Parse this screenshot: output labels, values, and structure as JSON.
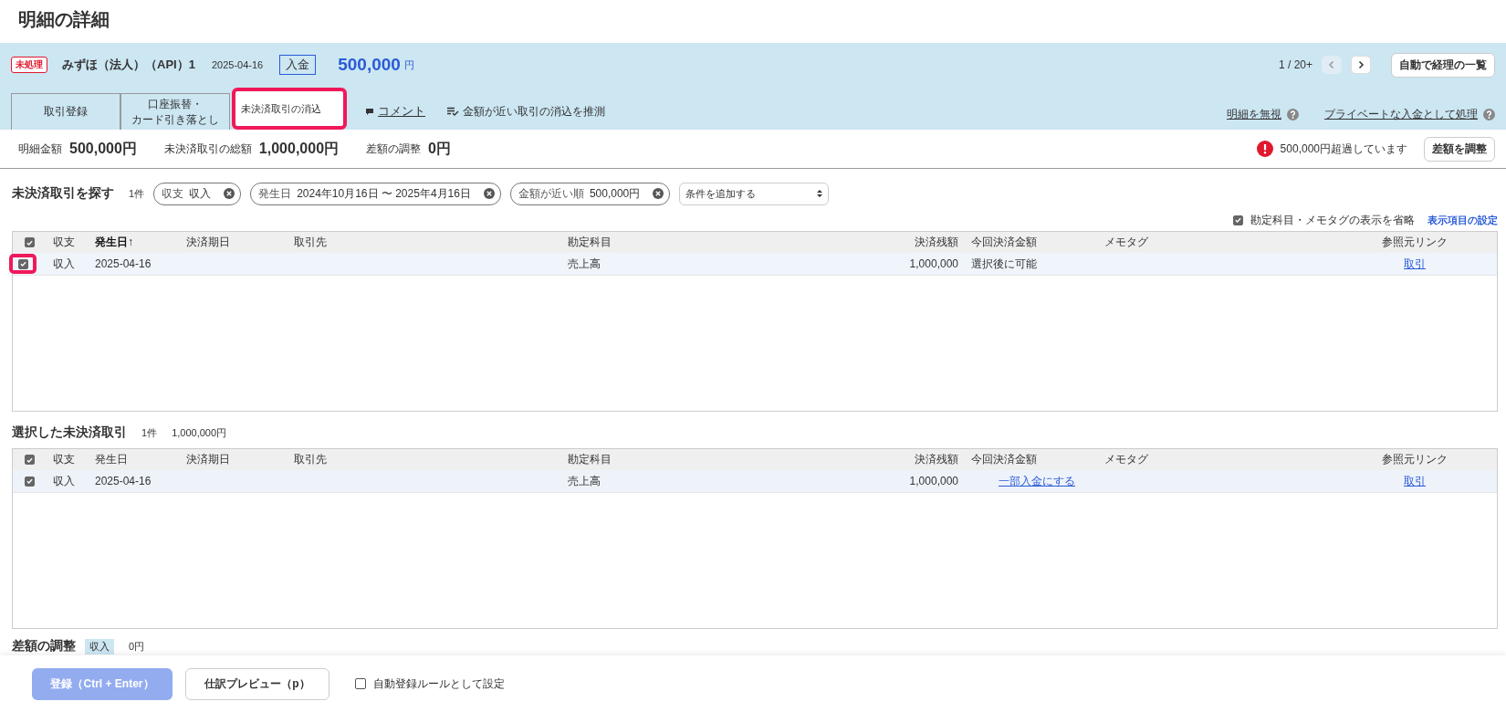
{
  "page_title": "明細の詳細",
  "header": {
    "status_badge": "未処理",
    "account": "みずほ（法人）（API）1",
    "date": "2025-04-16",
    "direction": "入金",
    "amount": "500,000",
    "currency": "円",
    "pager": {
      "position": "1 / 20+",
      "prev_disabled": true,
      "next_disabled": false
    },
    "list_button": "自動で経理の一覧"
  },
  "tabs": [
    {
      "kind": "tab",
      "label": "取引登録",
      "selected": false
    },
    {
      "kind": "tab2",
      "lines": [
        "口座振替・",
        "カード引き落とし"
      ],
      "selected": false
    },
    {
      "kind": "tab",
      "label": "未決済取引の消込",
      "selected": true
    },
    {
      "kind": "comment",
      "label": "コメント",
      "selected": false
    },
    {
      "kind": "guess",
      "label": "金額が近い取引の消込を推測",
      "selected": false
    }
  ],
  "header_links": [
    "明細を無視",
    "プライベートな入金として処理"
  ],
  "summary": [
    {
      "label": "明細金額",
      "value": "500,000円"
    },
    {
      "label": "未決済取引の総額",
      "value": "1,000,000円"
    },
    {
      "label": "差額の調整",
      "value": "0円"
    }
  ],
  "warning": "500,000円超過しています",
  "adjust_button": "差額を調整",
  "search": {
    "title": "未決済取引を探す",
    "count": "1件",
    "filters": [
      {
        "label": "収支",
        "value": "収入"
      },
      {
        "label": "発生日",
        "value": "2024年10月16日 〜 2025年4月16日"
      },
      {
        "label": "金額が近い順",
        "value": "500,000円"
      }
    ],
    "add_condition": "条件を追加する",
    "omit_option": {
      "label": "勘定科目・メモタグの表示を省略",
      "checked": true
    },
    "settings_link": "表示項目の設定"
  },
  "search_table": {
    "all_checked": true,
    "columns": [
      {
        "label": "収支",
        "sorted": false
      },
      {
        "label": "発生日",
        "sorted": true,
        "sort_arrow": "↑"
      },
      {
        "label": "決済期日",
        "sorted": false
      },
      {
        "label": "取引先",
        "sorted": false
      },
      {
        "label": "勘定科目",
        "sorted": false
      },
      {
        "label": "決済残額",
        "sorted": false
      },
      {
        "label": "今回決済金額",
        "sorted": false
      },
      {
        "label": "メモタグ",
        "sorted": false
      },
      {
        "label": "参照元リンク",
        "sorted": false
      }
    ],
    "rows": [
      {
        "checked": true,
        "highlighted": true,
        "type": "収入",
        "date": "2025-04-16",
        "amount_account": "売上高",
        "balance": "1,000,000",
        "payment": "選択後に可能",
        "payment_is_link": false,
        "link": "取引"
      }
    ]
  },
  "selected": {
    "title": "選択した未決済取引",
    "count": "1件",
    "total": "1,000,000円"
  },
  "selected_table": {
    "all_checked": true,
    "columns": [
      {
        "label": "収支",
        "sorted": false
      },
      {
        "label": "発生日",
        "sorted": false
      },
      {
        "label": "決済期日",
        "sorted": false
      },
      {
        "label": "取引先",
        "sorted": false
      },
      {
        "label": "勘定科目",
        "sorted": false
      },
      {
        "label": "決済残額",
        "sorted": false
      },
      {
        "label": "今回決済金額",
        "sorted": false
      },
      {
        "label": "メモタグ",
        "sorted": false
      },
      {
        "label": "参照元リンク",
        "sorted": false
      }
    ],
    "rows": [
      {
        "checked": true,
        "highlighted": false,
        "type": "収入",
        "date": "2025-04-16",
        "amount_account": "売上高",
        "balance": "1,000,000",
        "payment": "一部入金にする",
        "payment_is_link": true,
        "link": "取引"
      }
    ]
  },
  "adjustment": {
    "title": "差額の調整",
    "tag": "収入",
    "value": "0円"
  },
  "footer": {
    "register_button": "登録（Ctrl + Enter）",
    "register_disabled": true,
    "preview_button": "仕訳プレビュー（p）",
    "auto_rule": {
      "label": "自動登録ルールとして設定",
      "checked": false
    }
  }
}
